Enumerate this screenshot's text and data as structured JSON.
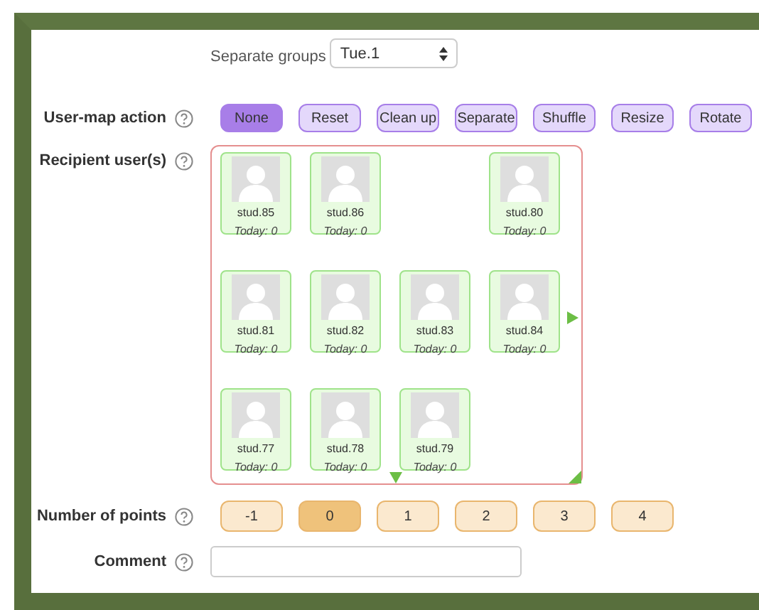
{
  "group_filter": {
    "label": "Separate groups",
    "value": "Tue.1"
  },
  "user_map_action": {
    "label": "User-map action",
    "options": [
      {
        "label": "None",
        "selected": true
      },
      {
        "label": "Reset",
        "selected": false
      },
      {
        "label": "Clean up",
        "selected": false
      },
      {
        "label": "Separate",
        "selected": false
      },
      {
        "label": "Shuffle",
        "selected": false
      },
      {
        "label": "Resize",
        "selected": false
      },
      {
        "label": "Rotate",
        "selected": false
      }
    ]
  },
  "recipient_users": {
    "label": "Recipient user(s)",
    "slots": [
      {
        "kind": "user",
        "name": "stud.85",
        "today": "Today: 0"
      },
      {
        "kind": "user",
        "name": "stud.86",
        "today": "Today: 0"
      },
      {
        "kind": "empty"
      },
      {
        "kind": "user",
        "name": "stud.80",
        "today": "Today: 0"
      },
      {
        "kind": "user",
        "name": "stud.81",
        "today": "Today: 0"
      },
      {
        "kind": "user",
        "name": "stud.82",
        "today": "Today: 0"
      },
      {
        "kind": "user",
        "name": "stud.83",
        "today": "Today: 0"
      },
      {
        "kind": "user",
        "name": "stud.84",
        "today": "Today: 0"
      },
      {
        "kind": "user",
        "name": "stud.77",
        "today": "Today: 0"
      },
      {
        "kind": "user",
        "name": "stud.78",
        "today": "Today: 0"
      },
      {
        "kind": "user",
        "name": "stud.79",
        "today": "Today: 0"
      }
    ]
  },
  "points": {
    "label": "Number of points",
    "options": [
      {
        "label": "-1",
        "selected": false
      },
      {
        "label": "0",
        "selected": true
      },
      {
        "label": "1",
        "selected": false
      },
      {
        "label": "2",
        "selected": false
      },
      {
        "label": "3",
        "selected": false
      },
      {
        "label": "4",
        "selected": false
      }
    ]
  },
  "comment": {
    "label": "Comment"
  }
}
